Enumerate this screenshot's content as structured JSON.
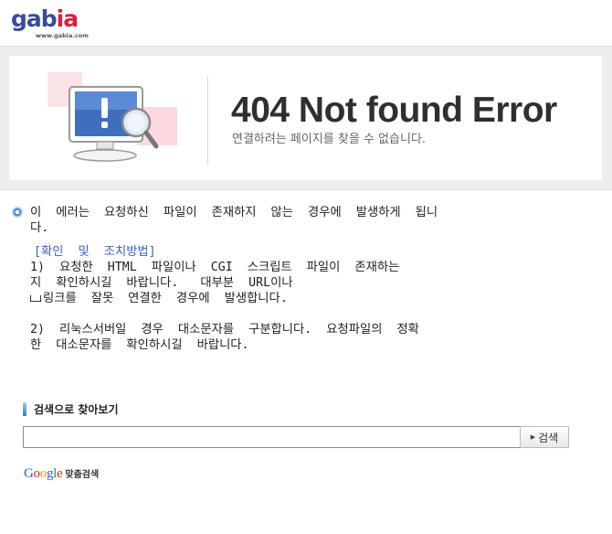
{
  "logo": {
    "word_left": "gab",
    "word_right": "ia",
    "url": "www.gabia.com"
  },
  "banner": {
    "title": "404 Not found Error",
    "subtitle": "연결하려는 페이지를 찾을 수 없습니다."
  },
  "message": {
    "line1": "이  에러는  요청하신  파일이  존재하지  않는  경우에  발생하게  됩니",
    "line2": "다.",
    "howto_heading": "[확인  및  조치방법]",
    "item1_line1": "1)  요청한  HTML  파일이나  CGI  스크립트  파일이  존재하는",
    "item1_line2": "지  확인하시길  바랍니다.   대부분  URL이나",
    "item1_line3": "링크를  잘못  연결한  경우에  발생합니다.",
    "item2_line1": "2)  리눅스서버일  경우  대소문자를  구분합니다.  요청파일의  정확",
    "item2_line2": "한  대소문자를  확인하시길  바랍니다."
  },
  "search": {
    "title": "검색으로 찾아보기",
    "input_value": "",
    "button_label": "검색"
  },
  "google": {
    "word": [
      "G",
      "o",
      "o",
      "g",
      "l",
      "e"
    ],
    "suffix": "맞춤검색"
  },
  "colors": {
    "logo_blue": "#3a4a9a",
    "logo_red": "#d8203c",
    "howto_blue": "#3a5fcd"
  },
  "icons": {
    "illustration": "monitor-alert-magnifier-icon",
    "bullet": "bullet-icon",
    "search_button_arrow": "triangle-right-icon"
  }
}
